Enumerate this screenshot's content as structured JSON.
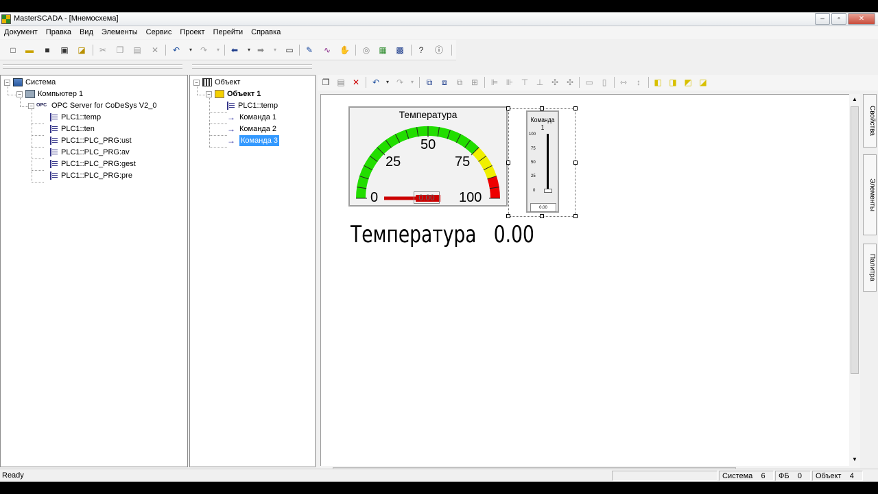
{
  "window": {
    "title": "MasterSCADA - [Мнемосхема]",
    "min": "‒",
    "max": "▫",
    "close": "✕"
  },
  "menu": [
    "Документ",
    "Правка",
    "Вид",
    "Элементы",
    "Сервис",
    "Проект",
    "Перейти",
    "Справка"
  ],
  "system_tree": {
    "root": "Система",
    "computer": "Компьютер 1",
    "opc": "OPC Server for CoDeSys V2_0",
    "opc_icon": "OPC",
    "tags": [
      "PLC1::temp",
      "PLC1::ten",
      "PLC1::PLC_PRG:ust",
      "PLC1::PLC_PRG:av",
      "PLC1::PLC_PRG:gest",
      "PLC1::PLC_PRG:pre"
    ]
  },
  "object_tree": {
    "root": "Объект",
    "object": "Объект 1",
    "children": [
      "PLC1::temp",
      "Команда 1",
      "Команда 2",
      "Команда 3"
    ],
    "selected": "Команда 3"
  },
  "gauge": {
    "title": "Температура",
    "ticks": [
      "0",
      "25",
      "50",
      "75",
      "100"
    ],
    "value_text": "0.00",
    "value_fraction": 0.0,
    "colors": {
      "green": "#22dd00",
      "yellow": "#f0f000",
      "red": "#ee0000"
    }
  },
  "label": {
    "name": "Температура",
    "value": "0.00"
  },
  "slider": {
    "title": "Команда 1",
    "scale": [
      "100",
      "75",
      "50",
      "25",
      "0"
    ],
    "value": "0.00"
  },
  "side_tabs": [
    "Свойства",
    "Элементы",
    "Палитра"
  ],
  "status": {
    "ready": "Ready",
    "sys_label": "Система",
    "sys_count": "6",
    "fb_label": "ФБ",
    "fb_count": "0",
    "obj_label": "Объект",
    "obj_count": "4"
  },
  "icons": [
    "new-icon",
    "open-icon",
    "save-icon",
    "save-all-icon",
    "lock-icon",
    "cut-icon",
    "copy-icon",
    "paste-icon",
    "delete-icon",
    "undo-icon",
    "redo-icon",
    "back-icon",
    "forward-icon",
    "window-icon",
    "pen-icon",
    "trend-icon",
    "hand-icon",
    "globe-icon",
    "build-icon",
    "run-icon",
    "help-icon",
    "info-icon"
  ]
}
